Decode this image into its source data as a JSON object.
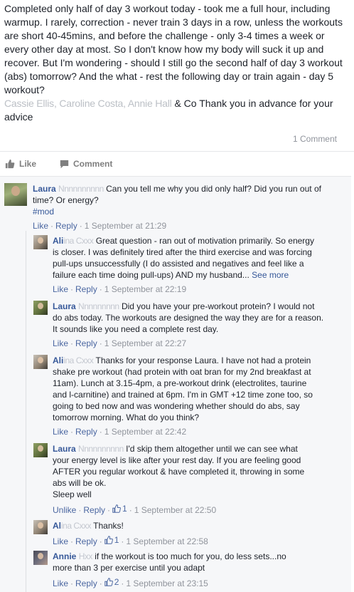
{
  "post": {
    "text": "Completed only half of day 3 workout today - took me a full hour, including warmup. I rarely, correction - never train 3 days in a row, unless the workouts are short 40-45mins, and before the challenge - only 3-4 times a week or every other day at most. So I don't know how my body will suck it up and recover. But I'm wondering - should I still go the second half of day 3 workout (abs) tomorrow? And the what - rest the following day or train again - day 5 workout?",
    "mentions_blurred": "Cassie Ellis, Caroline Costa, Annie Hall",
    "closing_text": " & Co Thank you in advance for your advice"
  },
  "comment_count": "1 Comment",
  "actions": {
    "like": "Like",
    "comment": "Comment"
  },
  "comments": [
    {
      "author": "Laura",
      "author_blur": "Nnnnnnnnnn",
      "text": "Can you tell me why you did only half? Did you run out of time? Or energy?",
      "tag": "#mod",
      "like": "Like",
      "reply": "Reply",
      "time": "1 September at 21:29"
    },
    {
      "author": "Ali",
      "author_blur": "ina Cxxx",
      "text": "Great question - ran out of motivation primarily. So energy is closer. I was definitely tired after the third exercise and was forcing pull-ups unsuccessfully (I do assisted and negatives and feel like a failure each time doing pull-ups) AND my husband...",
      "see_more": "See more",
      "like": "Like",
      "reply": "Reply",
      "time": "1 September at 22:19"
    },
    {
      "author": "Laura",
      "author_blur": "Nnnnnnnnn",
      "text": "Did you have your pre-workout protein? I would not do abs today. The workouts are designed the way they are for a reason. It sounds like you need a complete rest day.",
      "like": "Like",
      "reply": "Reply",
      "time": "1 September at 22:27"
    },
    {
      "author": "Ali",
      "author_blur": "ina Cxxx",
      "text": "Thanks for your response Laura. I have not had a protein shake pre workout (had protein with oat bran for my 2nd breakfast at 11am). Lunch at 3.15-4pm, a pre-workout drink (electrolites, taurine and l-carnitine) and trained at 6pm. I'm in GMT +12 time zone too, so going to bed now and was wondering whether should do abs, say tomorrow morning. What do you think?",
      "like": "Like",
      "reply": "Reply",
      "time": "1 September at 22:42"
    },
    {
      "author": "Laura",
      "author_blur": "Nnnnnnnnnn",
      "text": "I'd skip them altogether until we can see what your energy level is like after your rest day. If you are feeling good AFTER you regular workout & have completed it, throwing in some abs will be ok.",
      "text2": "Sleep well",
      "unlike": "Unlike",
      "reply": "Reply",
      "likes": "1",
      "time": "1 September at 22:50"
    },
    {
      "author": "Al",
      "author_blur": "ina Cxxx",
      "text": "Thanks!",
      "like": "Like",
      "reply": "Reply",
      "likes": "1",
      "time": "1 September at 22:58"
    },
    {
      "author": "Annie",
      "author_blur": "Hxx",
      "text": "if the workout is too much for you, do less sets...no more than 3 per exercise until you adapt",
      "like": "Like",
      "reply": "Reply",
      "likes": "2",
      "time": "1 September at 23:15"
    }
  ]
}
